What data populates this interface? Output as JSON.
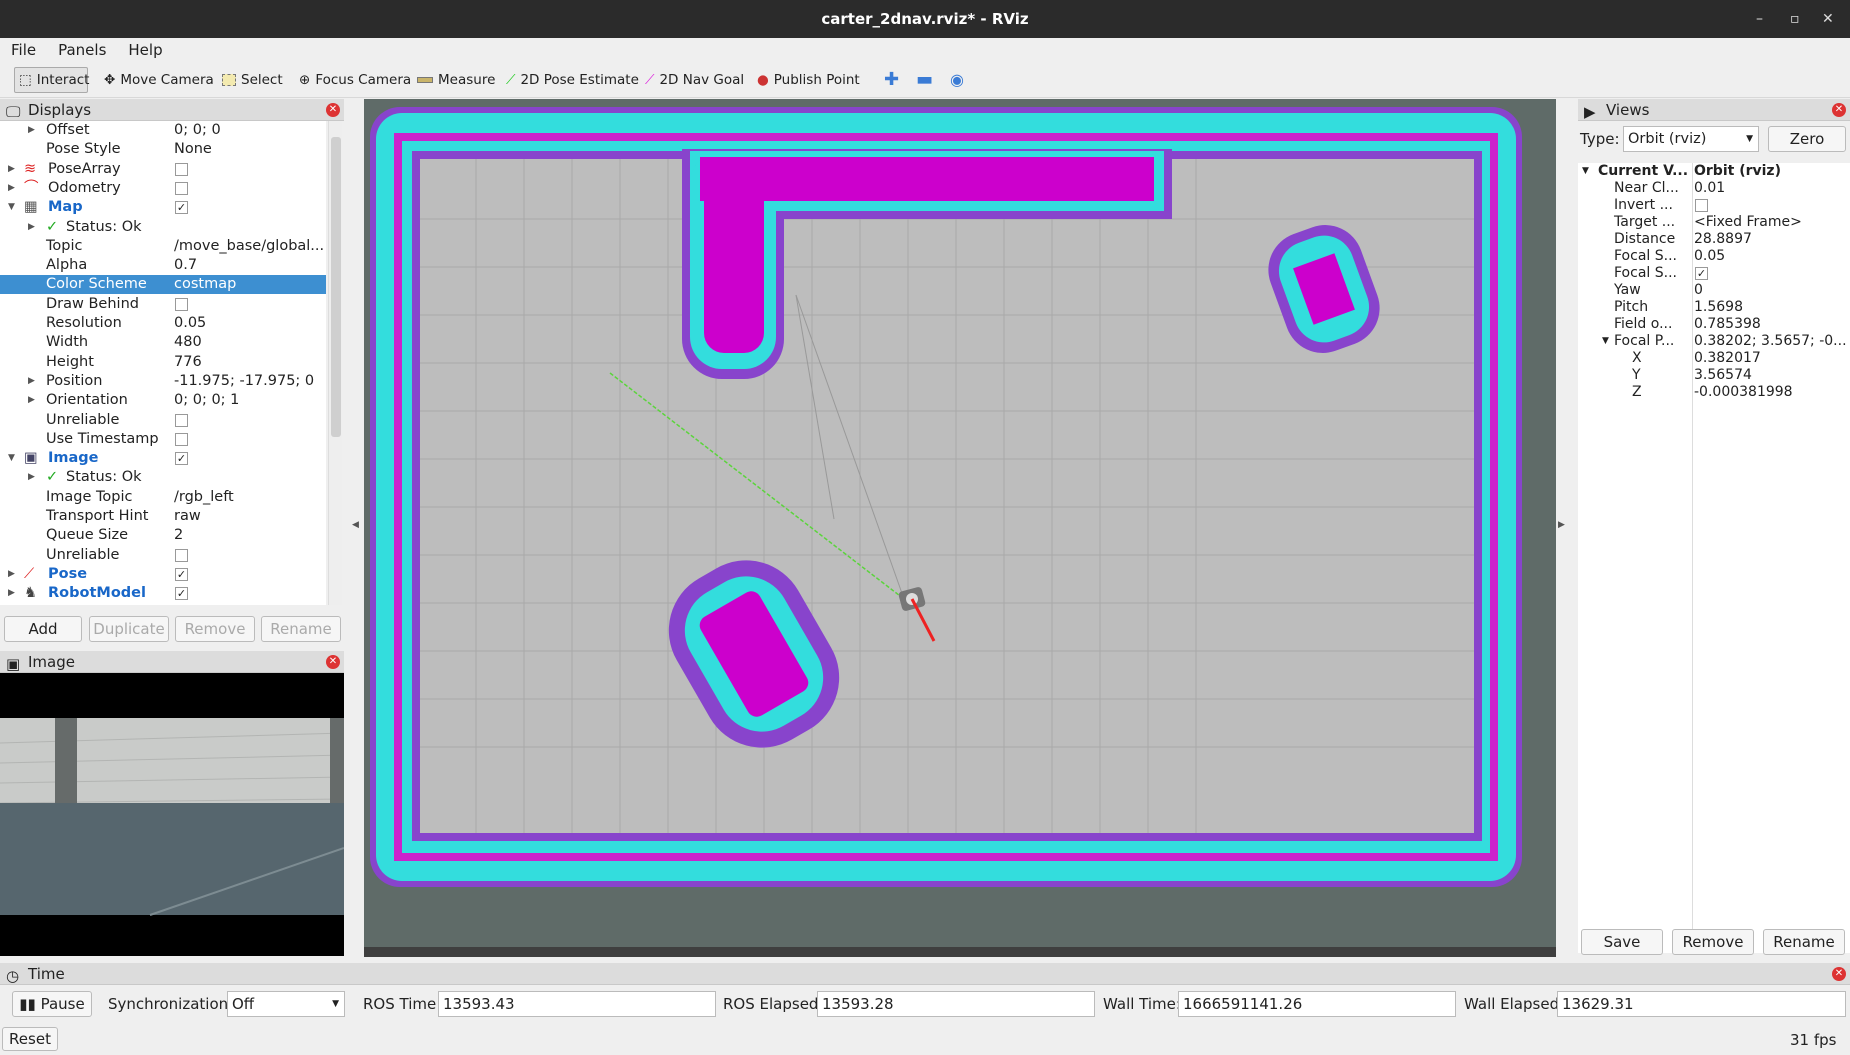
{
  "window": {
    "title": "carter_2dnav.rviz* - RViz"
  },
  "menu": [
    "File",
    "Panels",
    "Help"
  ],
  "toolbar": [
    {
      "label": "Interact",
      "icon": "cursor-icon",
      "active": true
    },
    {
      "label": "Move Camera",
      "icon": "move-camera-icon"
    },
    {
      "label": "Select",
      "icon": "select-icon"
    },
    {
      "label": "Focus Camera",
      "icon": "focus-camera-icon"
    },
    {
      "label": "Measure",
      "icon": "measure-icon"
    },
    {
      "label": "2D Pose Estimate",
      "icon": "green-arrow-icon"
    },
    {
      "label": "2D Nav Goal",
      "icon": "magenta-arrow-icon"
    },
    {
      "label": "Publish Point",
      "icon": "map-pin-icon"
    }
  ],
  "displays": {
    "title": "Displays",
    "rows": [
      {
        "label": "Offset",
        "value": "0; 0; 0",
        "indent": 1,
        "exp": true
      },
      {
        "label": "Pose Style",
        "value": "None",
        "indent": 1
      },
      {
        "label": "PoseArray",
        "indent": 0,
        "exp": true,
        "icon": "pose-array-icon",
        "check": false
      },
      {
        "label": "Odometry",
        "indent": 0,
        "exp": true,
        "icon": "odometry-icon",
        "check": false
      },
      {
        "label": "Map",
        "indent": 0,
        "exp": "open",
        "icon": "map-icon",
        "check": true,
        "blue": true
      },
      {
        "label": "Status: Ok",
        "indent": 1,
        "exp": true,
        "status": true
      },
      {
        "label": "Topic",
        "value": "/move_base/global...",
        "indent": 1
      },
      {
        "label": "Alpha",
        "value": "0.7",
        "indent": 1
      },
      {
        "label": "Color Scheme",
        "value": "costmap",
        "indent": 1,
        "selected": true
      },
      {
        "label": "Draw Behind",
        "indent": 1,
        "check": false
      },
      {
        "label": "Resolution",
        "value": "0.05",
        "indent": 1
      },
      {
        "label": "Width",
        "value": "480",
        "indent": 1
      },
      {
        "label": "Height",
        "value": "776",
        "indent": 1
      },
      {
        "label": "Position",
        "value": "-11.975; -17.975; 0",
        "indent": 1,
        "exp": true
      },
      {
        "label": "Orientation",
        "value": "0; 0; 0; 1",
        "indent": 1,
        "exp": true
      },
      {
        "label": "Unreliable",
        "indent": 1,
        "check": false
      },
      {
        "label": "Use Timestamp",
        "indent": 1,
        "check": false
      },
      {
        "label": "Image",
        "indent": 0,
        "exp": "open",
        "icon": "image-icon",
        "check": true,
        "blue": true
      },
      {
        "label": "Status: Ok",
        "indent": 1,
        "exp": true,
        "status": true
      },
      {
        "label": "Image Topic",
        "value": "/rgb_left",
        "indent": 1
      },
      {
        "label": "Transport Hint",
        "value": "raw",
        "indent": 1
      },
      {
        "label": "Queue Size",
        "value": "2",
        "indent": 1
      },
      {
        "label": "Unreliable",
        "indent": 1,
        "check": false
      },
      {
        "label": "Pose",
        "indent": 0,
        "exp": true,
        "icon": "pose-icon",
        "check": true,
        "blue": true
      },
      {
        "label": "RobotModel",
        "indent": 0,
        "exp": true,
        "icon": "robot-model-icon",
        "check": true,
        "blue": true
      }
    ],
    "buttons": [
      "Add",
      "Duplicate",
      "Remove",
      "Rename"
    ]
  },
  "image_panel": {
    "title": "Image"
  },
  "views": {
    "title": "Views",
    "type_label": "Type:",
    "type_value": "Orbit (rviz)",
    "zero": "Zero",
    "rows": [
      {
        "label": "Current V...",
        "value": "Orbit (rviz)",
        "bold": true,
        "exp": "open",
        "indent": 0
      },
      {
        "label": "Near Cl...",
        "value": "0.01",
        "indent": 1
      },
      {
        "label": "Invert ...",
        "check": false,
        "indent": 1
      },
      {
        "label": "Target ...",
        "value": "<Fixed Frame>",
        "indent": 1
      },
      {
        "label": "Distance",
        "value": "28.8897",
        "indent": 1
      },
      {
        "label": "Focal S...",
        "value": "0.05",
        "indent": 1
      },
      {
        "label": "Focal S...",
        "check": true,
        "indent": 1
      },
      {
        "label": "Yaw",
        "value": "0",
        "indent": 1
      },
      {
        "label": "Pitch",
        "value": "1.5698",
        "indent": 1
      },
      {
        "label": "Field o...",
        "value": "0.785398",
        "indent": 1
      },
      {
        "label": "Focal P...",
        "value": "0.38202; 3.5657; -0....",
        "exp": "open",
        "indent": 1
      },
      {
        "label": "X",
        "value": "0.382017",
        "indent": 2
      },
      {
        "label": "Y",
        "value": "3.56574",
        "indent": 2
      },
      {
        "label": "Z",
        "value": "-0.000381998",
        "indent": 2
      }
    ],
    "buttons": [
      "Save",
      "Remove",
      "Rename"
    ]
  },
  "time": {
    "title": "Time",
    "pause": "Pause",
    "sync_label": "Synchronization:",
    "sync_value": "Off",
    "ros_time_label": "ROS Time:",
    "ros_time": "13593.43",
    "ros_elapsed_label": "ROS Elapsed:",
    "ros_elapsed": "13593.28",
    "wall_time_label": "Wall Time:",
    "wall_time": "1666591141.26",
    "wall_elapsed_label": "Wall Elapsed:",
    "wall_elapsed": "13629.31",
    "reset": "Reset",
    "fps": "31 fps"
  },
  "colors": {
    "costmap_lethal": "#cc00cc",
    "costmap_inflated": "#33dddd",
    "costmap_outer": "#7a2bb8",
    "free": "#bdbdbd",
    "background": "#5f6b68"
  }
}
